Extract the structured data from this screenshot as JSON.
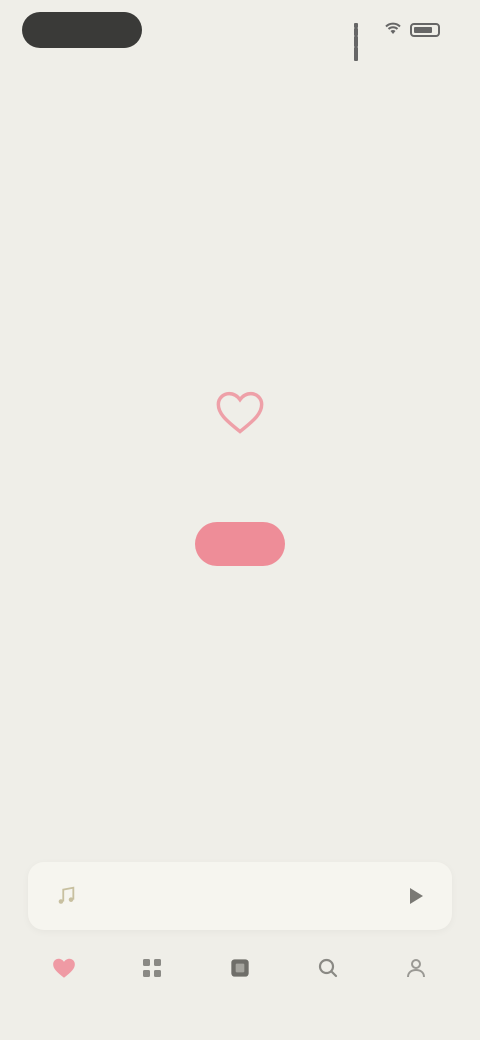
{
  "status_bar": {
    "time": "",
    "battery": ""
  },
  "header": {
    "title": ""
  },
  "empty_state": {
    "icon": "heart-icon",
    "title": "",
    "subtitle": "",
    "button_label": ""
  },
  "mini_player": {
    "art_icon": "music-note-icon",
    "title": "",
    "subtitle": "",
    "play_icon": "play-icon"
  },
  "tabs": [
    {
      "label": "",
      "icon": "heart-icon",
      "active": true
    },
    {
      "label": "",
      "icon": "grid-icon",
      "active": false
    },
    {
      "label": "",
      "icon": "library-icon",
      "active": false
    },
    {
      "label": "",
      "icon": "search-icon",
      "active": false
    },
    {
      "label": "",
      "icon": "profile-icon",
      "active": false
    }
  ],
  "colors": {
    "background": "#efeee8",
    "accent": "#ee8d98",
    "dark_pill": "#3a3a38"
  }
}
